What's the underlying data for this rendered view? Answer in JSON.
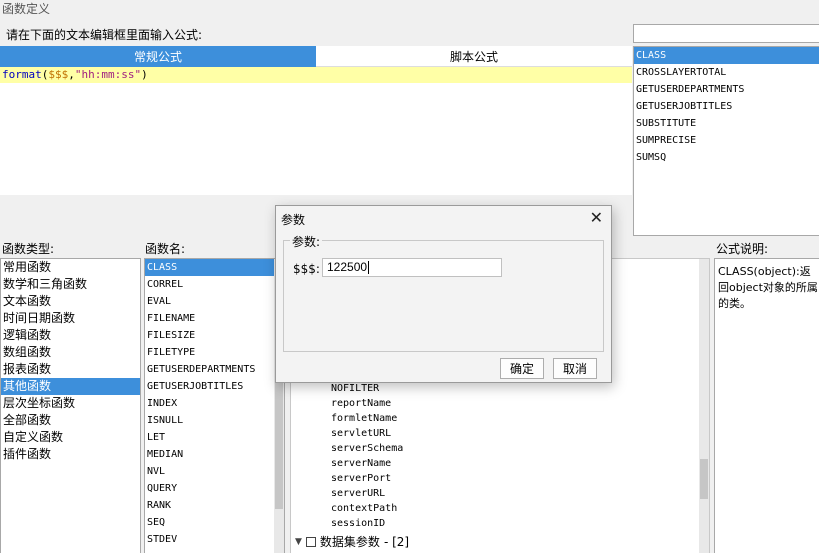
{
  "window": {
    "title": "函数定义"
  },
  "editor": {
    "prompt": "请在下面的文本编辑框里面输入公式:",
    "tabs": [
      {
        "label": "常规公式",
        "active": true
      },
      {
        "label": "脚本公式",
        "active": false
      }
    ],
    "formula": {
      "func": "format",
      "open": "(",
      "arg": "$$$",
      "comma": ",",
      "str": "\"hh:mm:ss\"",
      "close": ")"
    }
  },
  "search": {
    "value": ""
  },
  "search_results": [
    "CLASS",
    "CROSSLAYERTOTAL",
    "GETUSERDEPARTMENTS",
    "GETUSERJOBTITLES",
    "SUBSTITUTE",
    "SUMPRECISE",
    "SUMSQ"
  ],
  "function_types": {
    "label": "函数类型:",
    "items": [
      "常用函数",
      "数学和三角函数",
      "文本函数",
      "时间日期函数",
      "逻辑函数",
      "数组函数",
      "报表函数",
      "其他函数",
      "层次坐标函数",
      "全部函数",
      "自定义函数",
      "插件函数"
    ],
    "selected_index": 7
  },
  "function_names": {
    "label": "函数名:",
    "items": [
      "CLASS",
      "CORREL",
      "EVAL",
      "FILENAME",
      "FILESIZE",
      "FILETYPE",
      "GETUSERDEPARTMENTS",
      "GETUSERJOBTITLES",
      "INDEX",
      "ISNULL",
      "LET",
      "MEDIAN",
      "NVL",
      "QUERY",
      "RANK",
      "SEQ",
      "STDEV"
    ],
    "selected_index": 0
  },
  "tree": {
    "items": [
      "NOFILTER",
      "reportName",
      "formletName",
      "servletURL",
      "serverSchema",
      "serverName",
      "serverPort",
      "serverURL",
      "contextPath",
      "sessionID"
    ],
    "group": {
      "label": "数据集参数",
      "count": "- [2]"
    }
  },
  "description": {
    "label": "公式说明:",
    "text": "CLASS(object):返回object对象的所属的类。"
  },
  "dialog": {
    "title": "参数",
    "group_label": "参数:",
    "param_name": "$$$:",
    "param_value": "122500",
    "ok_label": "确定",
    "cancel_label": "取消"
  },
  "colors": {
    "accent": "#3d8fdb",
    "editor_line": "#ffffa6"
  }
}
